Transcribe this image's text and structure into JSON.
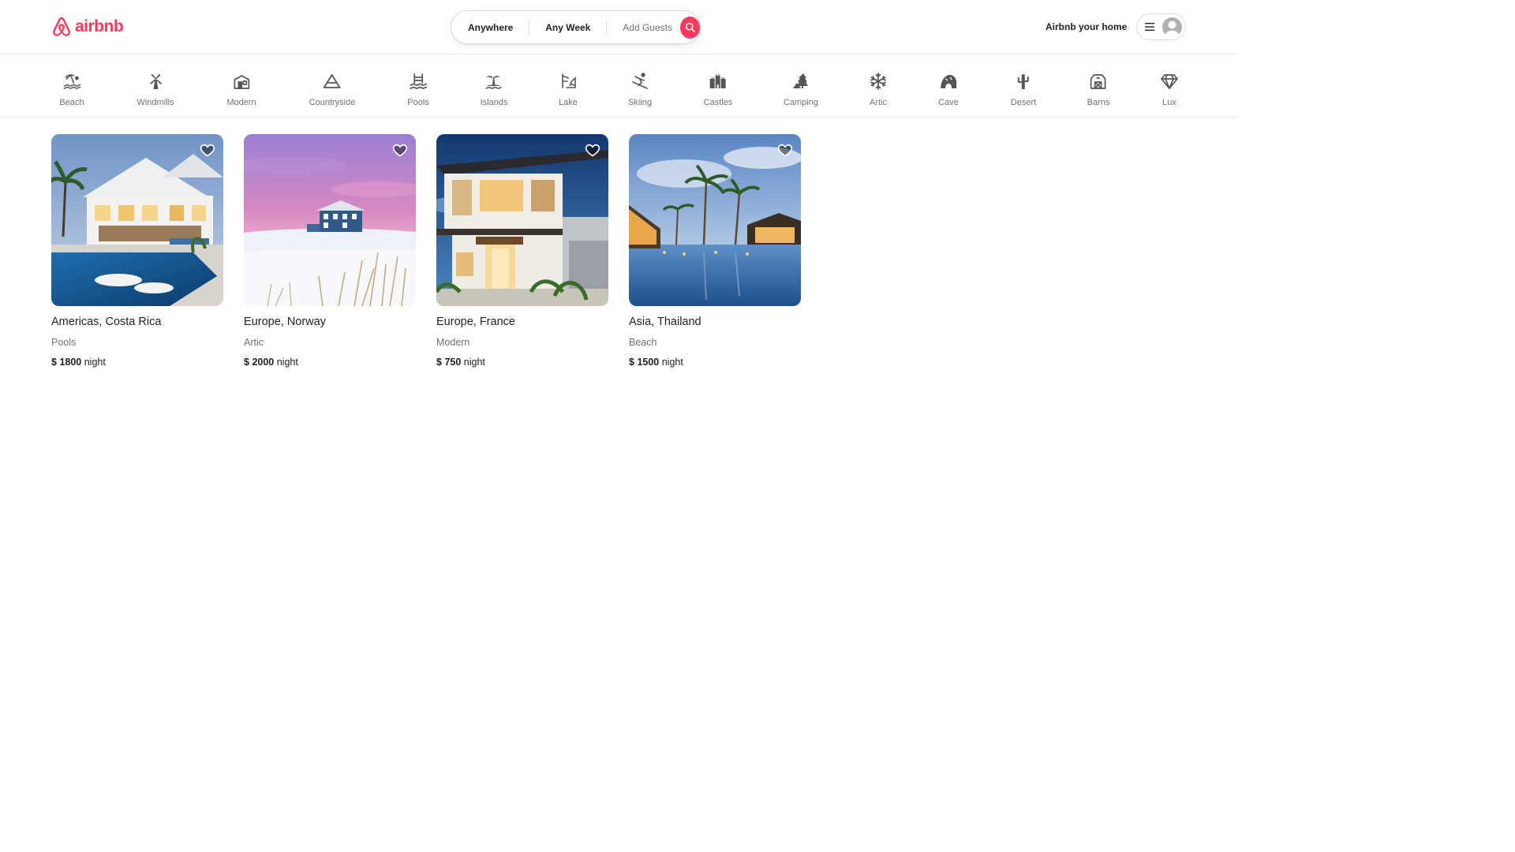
{
  "brand": {
    "name": "airbnb",
    "color": "#ff385c"
  },
  "search": {
    "location": "Anywhere",
    "week": "Any Week",
    "guests": "Add Guests"
  },
  "header": {
    "host_link": "Airbnb your home",
    "menu_icon": "hamburger-icon",
    "avatar_icon": "user-avatar-icon"
  },
  "categories": [
    {
      "label": "Beach",
      "icon": "beach-icon"
    },
    {
      "label": "Windmills",
      "icon": "windmill-icon"
    },
    {
      "label": "Modern",
      "icon": "modern-house-icon"
    },
    {
      "label": "Countryside",
      "icon": "mountain-icon"
    },
    {
      "label": "Pools",
      "icon": "pool-icon"
    },
    {
      "label": "Islands",
      "icon": "island-icon"
    },
    {
      "label": "Lake",
      "icon": "lake-icon"
    },
    {
      "label": "Skiing",
      "icon": "skiing-icon"
    },
    {
      "label": "Castles",
      "icon": "castle-icon"
    },
    {
      "label": "Camping",
      "icon": "camping-icon"
    },
    {
      "label": "Artic",
      "icon": "snowflake-icon"
    },
    {
      "label": "Cave",
      "icon": "cave-icon"
    },
    {
      "label": "Desert",
      "icon": "cactus-icon"
    },
    {
      "label": "Barns",
      "icon": "barn-icon"
    },
    {
      "label": "Lux",
      "icon": "diamond-icon"
    }
  ],
  "listings": [
    {
      "location": "Americas, Costa Rica",
      "category": "Pools",
      "currency": "$",
      "price": "1800",
      "unit": "night"
    },
    {
      "location": "Europe, Norway",
      "category": "Artic",
      "currency": "$",
      "price": "2000",
      "unit": "night"
    },
    {
      "location": "Europe, France",
      "category": "Modern",
      "currency": "$",
      "price": "750",
      "unit": "night"
    },
    {
      "location": "Asia, Thailand",
      "category": "Beach",
      "currency": "$",
      "price": "1500",
      "unit": "night"
    }
  ]
}
